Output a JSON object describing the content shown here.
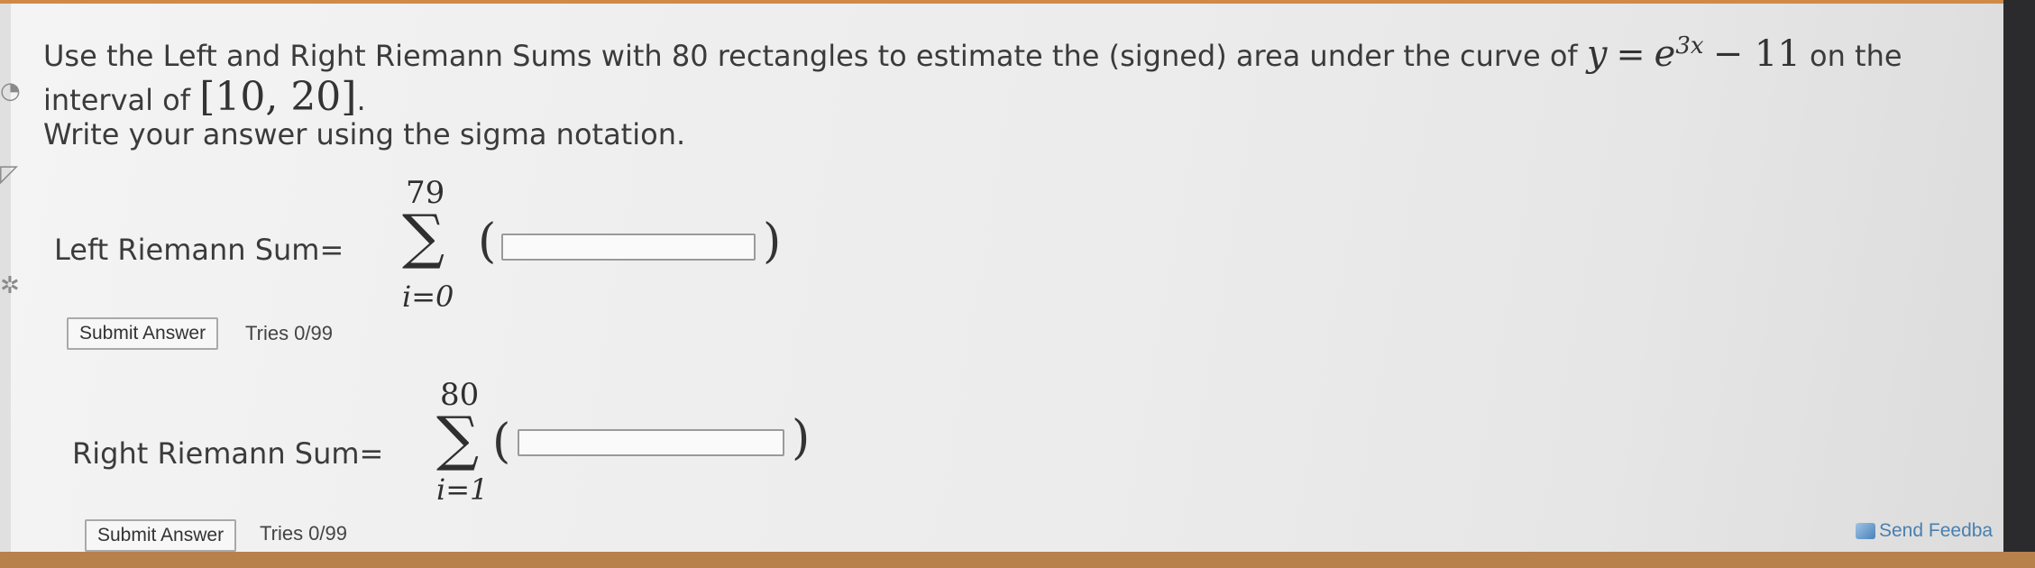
{
  "question": {
    "line1_prefix": "Use the Left and Right Riemann Sums with 80 rectangles to estimate the (signed) area under the curve of",
    "equation_y": "y",
    "equation_eq": "=",
    "equation_base": "e",
    "equation_exp": "3x",
    "equation_tail": "− 11",
    "line1_suffix": "on the",
    "line2_prefix": "interval of",
    "interval": "[10, 20]",
    "line2_end": ".",
    "line3": "Write your answer using the sigma notation."
  },
  "left_sum": {
    "label": "Left Riemann Sum=",
    "upper": "79",
    "lower": "i=0",
    "open_paren": "(",
    "close_paren": ")",
    "input_value": "",
    "submit_label": "Submit Answer",
    "tries": "Tries 0/99"
  },
  "right_sum": {
    "label": "Right Riemann Sum=",
    "upper": "80",
    "lower": "i=1",
    "open_paren": "(",
    "close_paren": ")",
    "input_value": "",
    "submit_label": "Submit Answer",
    "tries": "Tries 0/99"
  },
  "feedback": {
    "label": "Send Feedba",
    "icon": "feedback-icon"
  }
}
